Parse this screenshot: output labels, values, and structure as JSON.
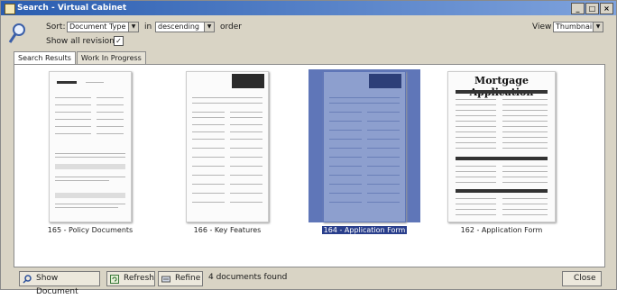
{
  "window": {
    "title": "Search - Virtual Cabinet",
    "controls": [
      "_",
      "□",
      "×"
    ]
  },
  "search": {
    "sort_label": "Sort:",
    "sort_value": "Document Type",
    "in_label": "in",
    "order_value": "descending",
    "order_label": "order",
    "show_revisions_label": "Show all revisions",
    "show_revisions_checked": "✓",
    "view_label": "View",
    "view_value": "Thumbnails"
  },
  "tabs": [
    {
      "label": "Search Results"
    },
    {
      "label": "Work In Progress"
    }
  ],
  "documents": [
    {
      "caption": "165 - Policy Documents"
    },
    {
      "caption": "166 - Key Features"
    },
    {
      "caption": "164 - Application Form"
    },
    {
      "caption": "162 - Application Form",
      "heading": "Mortgage Application"
    }
  ],
  "toolbar": {
    "show_document": "Show Document",
    "refresh": "Refresh",
    "refine": "Refine",
    "status": "4 documents found",
    "close": "Close"
  },
  "colors": {
    "selection": "#2a3f8c",
    "titlebar": "#2a5db0",
    "chrome": "#d9d4c5"
  }
}
